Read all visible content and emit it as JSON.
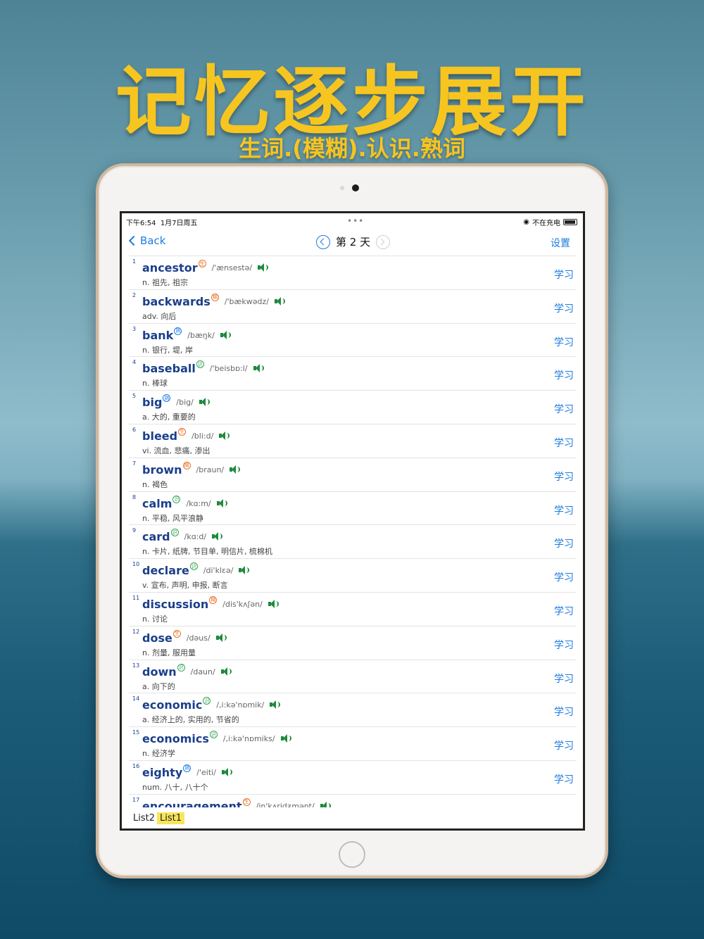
{
  "hero": {
    "title": "记忆逐步展开",
    "subtitle": "生词.(模糊).认识.熟词"
  },
  "status": {
    "time": "下午6:54",
    "date": "1月7日周五",
    "charging": "不在充电"
  },
  "nav": {
    "back": "Back",
    "title": "第 2 天",
    "settings": "设置"
  },
  "learn_label": "学习",
  "words": [
    {
      "n": "1",
      "word": "ancestor",
      "badge": "生",
      "badge_type": "new",
      "phonetic": "/'ænsestə/",
      "def": "n. 祖先, 祖宗"
    },
    {
      "n": "2",
      "word": "backwards",
      "badge": "糊",
      "badge_type": "blur",
      "phonetic": "/'bækwədz/",
      "def": "adv. 向后"
    },
    {
      "n": "3",
      "word": "bank",
      "badge": "熟",
      "badge_type": "fam",
      "phonetic": "/bæŋk/",
      "def": "n. 银行, 堤, 岸"
    },
    {
      "n": "4",
      "word": "baseball",
      "badge": "识",
      "badge_type": "know",
      "phonetic": "/'beisbɒ:l/",
      "def": "n. 棒球"
    },
    {
      "n": "5",
      "word": "big",
      "badge": "熟",
      "badge_type": "fam",
      "phonetic": "/big/",
      "def": "a. 大的, 重要的"
    },
    {
      "n": "6",
      "word": "bleed",
      "badge": "生",
      "badge_type": "new",
      "phonetic": "/bli:d/",
      "def": "vi. 流血, 悲痛, 渗出"
    },
    {
      "n": "7",
      "word": "brown",
      "badge": "糊",
      "badge_type": "blur",
      "phonetic": "/braun/",
      "def": "n. 褐色"
    },
    {
      "n": "8",
      "word": "calm",
      "badge": "识",
      "badge_type": "know",
      "phonetic": "/kɑ:m/",
      "def": "n. 平稳, 风平浪静"
    },
    {
      "n": "9",
      "word": "card",
      "badge": "识",
      "badge_type": "know",
      "phonetic": "/kɑ:d/",
      "def": "n. 卡片, 纸牌, 节目单, 明信片, 梳棉机"
    },
    {
      "n": "10",
      "word": "declare",
      "badge": "识",
      "badge_type": "know",
      "phonetic": "/di'klεə/",
      "def": "v. 宣布, 声明, 申报, 断言"
    },
    {
      "n": "11",
      "word": "discussion",
      "badge": "糊",
      "badge_type": "blur",
      "phonetic": "/dis'kʌʃən/",
      "def": "n. 讨论"
    },
    {
      "n": "12",
      "word": "dose",
      "badge": "生",
      "badge_type": "new",
      "phonetic": "/dəus/",
      "def": "n. 剂量, 服用量"
    },
    {
      "n": "13",
      "word": "down",
      "badge": "识",
      "badge_type": "know",
      "phonetic": "/daun/",
      "def": "a. 向下的"
    },
    {
      "n": "14",
      "word": "economic",
      "badge": "识",
      "badge_type": "know",
      "phonetic": "/,i:kə'nɒmik/",
      "def": "a. 经济上的, 实用的, 节省的"
    },
    {
      "n": "15",
      "word": "economics",
      "badge": "识",
      "badge_type": "know",
      "phonetic": "/,i:kə'nɒmiks/",
      "def": "n. 经济学"
    },
    {
      "n": "16",
      "word": "eighty",
      "badge": "熟",
      "badge_type": "fam",
      "phonetic": "/'eiti/",
      "def": "num. 八十, 八十个"
    }
  ],
  "partial_word": {
    "n": "17",
    "word": "encouragement",
    "badge": "生",
    "badge_type": "new",
    "phonetic": "/in'kʌridʒmənt/"
  },
  "tabs": [
    "List2",
    "List1"
  ],
  "active_tab": "List1",
  "colors": {
    "accent": "#1e7be0",
    "title_yellow": "#f7c520",
    "word_blue": "#1b3f8b",
    "speaker_green": "#1e8a3c"
  }
}
